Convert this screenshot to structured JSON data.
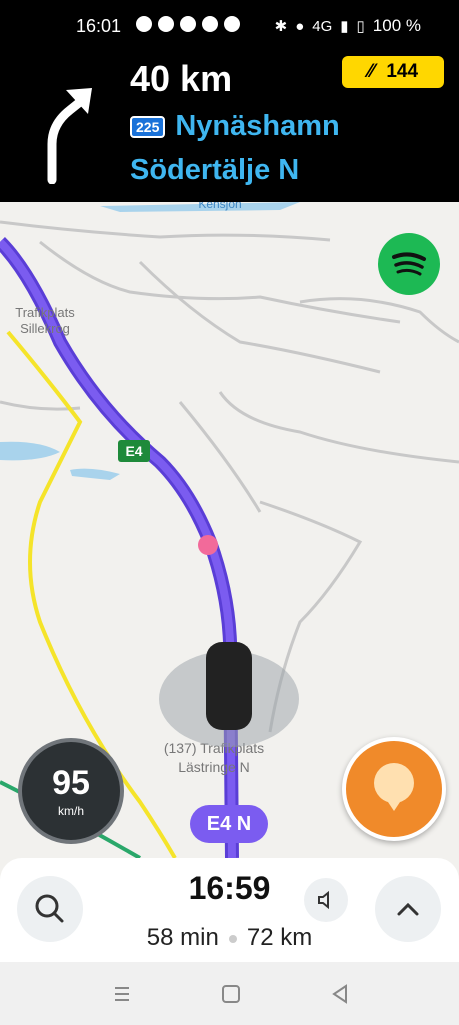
{
  "status_bar": {
    "time": "16:01",
    "network": "4G",
    "battery": "100 %"
  },
  "nav_instruction": {
    "distance": "40 km",
    "road_shield": "225",
    "road_name": "Nynäshamn",
    "exit_name": "Södertälje N",
    "route_badge": "144"
  },
  "map": {
    "labels": {
      "lake": "Kensjön",
      "interchange_1_line1": "Trafikplats",
      "interchange_1_line2": "Sillekrog",
      "highway_shield": "E4",
      "interchange_2_line1": "(137) Trafikplats",
      "interchange_2_line2": "Lästringe N"
    },
    "current_road": "E4 N"
  },
  "speedometer": {
    "speed": "95",
    "unit": "km/h"
  },
  "eta": {
    "arrival_time": "16:59",
    "duration": "58 min",
    "distance": "72 km"
  },
  "colors": {
    "route": "#7b5cf0",
    "road_yellow": "#f5e42a",
    "accent_blue": "#3fb6f0",
    "spotify": "#1db954"
  },
  "icons": {
    "turn": "turn-right-arrow-icon",
    "search": "search-icon",
    "expand": "chevron-up-icon",
    "sound": "speaker-icon",
    "report": "report-pin-icon",
    "spotify": "spotify-icon"
  }
}
